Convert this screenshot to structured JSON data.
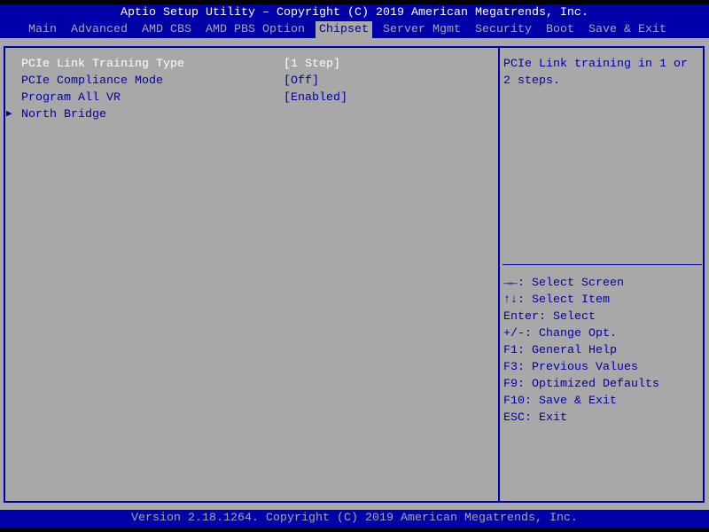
{
  "title": "Aptio Setup Utility – Copyright (C) 2019 American Megatrends, Inc.",
  "tabs": [
    {
      "label": "Main",
      "active": false
    },
    {
      "label": "Advanced",
      "active": false
    },
    {
      "label": "AMD CBS",
      "active": false
    },
    {
      "label": "AMD PBS Option",
      "active": false
    },
    {
      "label": "Chipset",
      "active": true
    },
    {
      "label": "Server Mgmt",
      "active": false
    },
    {
      "label": "Security",
      "active": false
    },
    {
      "label": "Boot",
      "active": false
    },
    {
      "label": "Save & Exit",
      "active": false
    }
  ],
  "settings": [
    {
      "label": "PCIe Link Training Type",
      "value": "[1 Step]",
      "selected": true
    },
    {
      "label": "PCIe Compliance Mode",
      "value": "[Off]",
      "selected": false
    },
    {
      "label": "Program All VR",
      "value": "[Enabled]",
      "selected": false
    }
  ],
  "submenu": {
    "label": "North Bridge",
    "icon": "triangle-right-icon"
  },
  "help_text": [
    "PCIe Link training in 1 or",
    "2 steps."
  ],
  "key_help": [
    "→←: Select Screen",
    "↑↓: Select Item",
    "Enter: Select",
    "+/-: Change Opt.",
    "F1: General Help",
    "F3: Previous Values",
    "F9: Optimized Defaults",
    "F10: Save & Exit",
    "ESC: Exit"
  ],
  "footer": "Version 2.18.1264. Copyright (C) 2019 American Megatrends, Inc.",
  "colors": {
    "blue": "#0000a8",
    "gray": "#a8a8a8",
    "white": "#ffffff"
  }
}
